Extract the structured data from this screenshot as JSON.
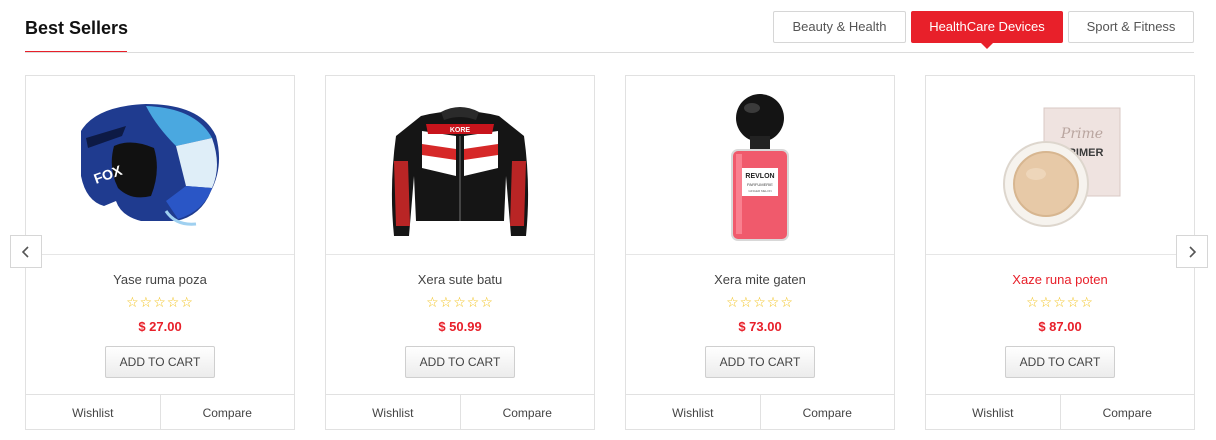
{
  "section": {
    "title": "Best Sellers"
  },
  "tabs": [
    {
      "label": "Beauty & Health",
      "active": false
    },
    {
      "label": "HealthCare Devices",
      "active": true
    },
    {
      "label": "Sport & Fitness",
      "active": false
    }
  ],
  "products": [
    {
      "name": "Yase ruma poza",
      "price": "$ 27.00",
      "stars": "☆☆☆☆☆",
      "image": "motocross-helmet",
      "highlighted": false
    },
    {
      "name": "Xera sute batu",
      "price": "$ 50.99",
      "stars": "☆☆☆☆☆",
      "image": "leather-jacket",
      "highlighted": false
    },
    {
      "name": "Xera mite gaten",
      "price": "$ 73.00",
      "stars": "☆☆☆☆☆",
      "image": "perfume-bottle",
      "highlighted": false
    },
    {
      "name": "Xaze runa poten",
      "price": "$ 87.00",
      "stars": "☆☆☆☆☆",
      "image": "primer-compact",
      "highlighted": true
    }
  ],
  "product_labels": {
    "add_to_cart": "ADD TO CART",
    "wishlist": "Wishlist",
    "compare": "Compare"
  },
  "image_text": {
    "jacket_brand": "KORE",
    "perfume_brand": "REVLON",
    "perfume_sub": "PARFUMERIE",
    "perfume_small": "GINGER MELON",
    "primer_script": "Prime",
    "primer_word": "PRIMER"
  },
  "icons": {
    "prev": "chevron-left-icon",
    "next": "chevron-right-icon"
  },
  "colors": {
    "accent": "#e8202a",
    "star": "#f2c21b"
  }
}
